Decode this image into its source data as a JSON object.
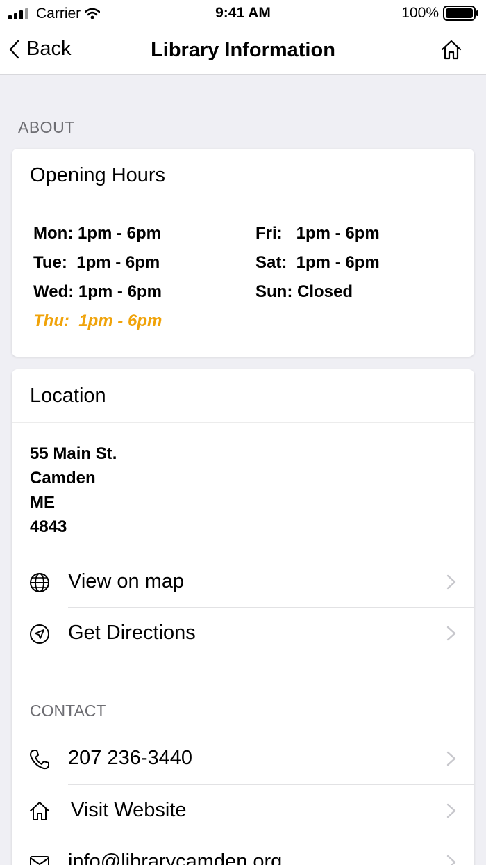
{
  "status_bar": {
    "carrier": "Carrier",
    "time": "9:41 AM",
    "battery": "100%"
  },
  "nav": {
    "back_label": "Back",
    "title": "Library Information"
  },
  "about": {
    "section_label": "ABOUT",
    "hours_title": "Opening Hours",
    "hours_left": [
      "Mon: 1pm - 6pm",
      "Tue:  1pm - 6pm",
      "Wed: 1pm - 6pm",
      "Thu:  1pm - 6pm"
    ],
    "hours_right": [
      "Fri:   1pm - 6pm",
      "Sat:  1pm - 6pm",
      "Sun: Closed"
    ],
    "highlight_color": "#f0a30a"
  },
  "location": {
    "title": "Location",
    "address": [
      "55 Main St.",
      "Camden",
      "ME",
      "4843"
    ],
    "view_on_map": "View on map",
    "get_directions": "Get Directions"
  },
  "contact": {
    "section_label": "CONTACT",
    "phone": "207 236-3440",
    "website": "Visit Website",
    "email": "info@librarycamden.org"
  }
}
